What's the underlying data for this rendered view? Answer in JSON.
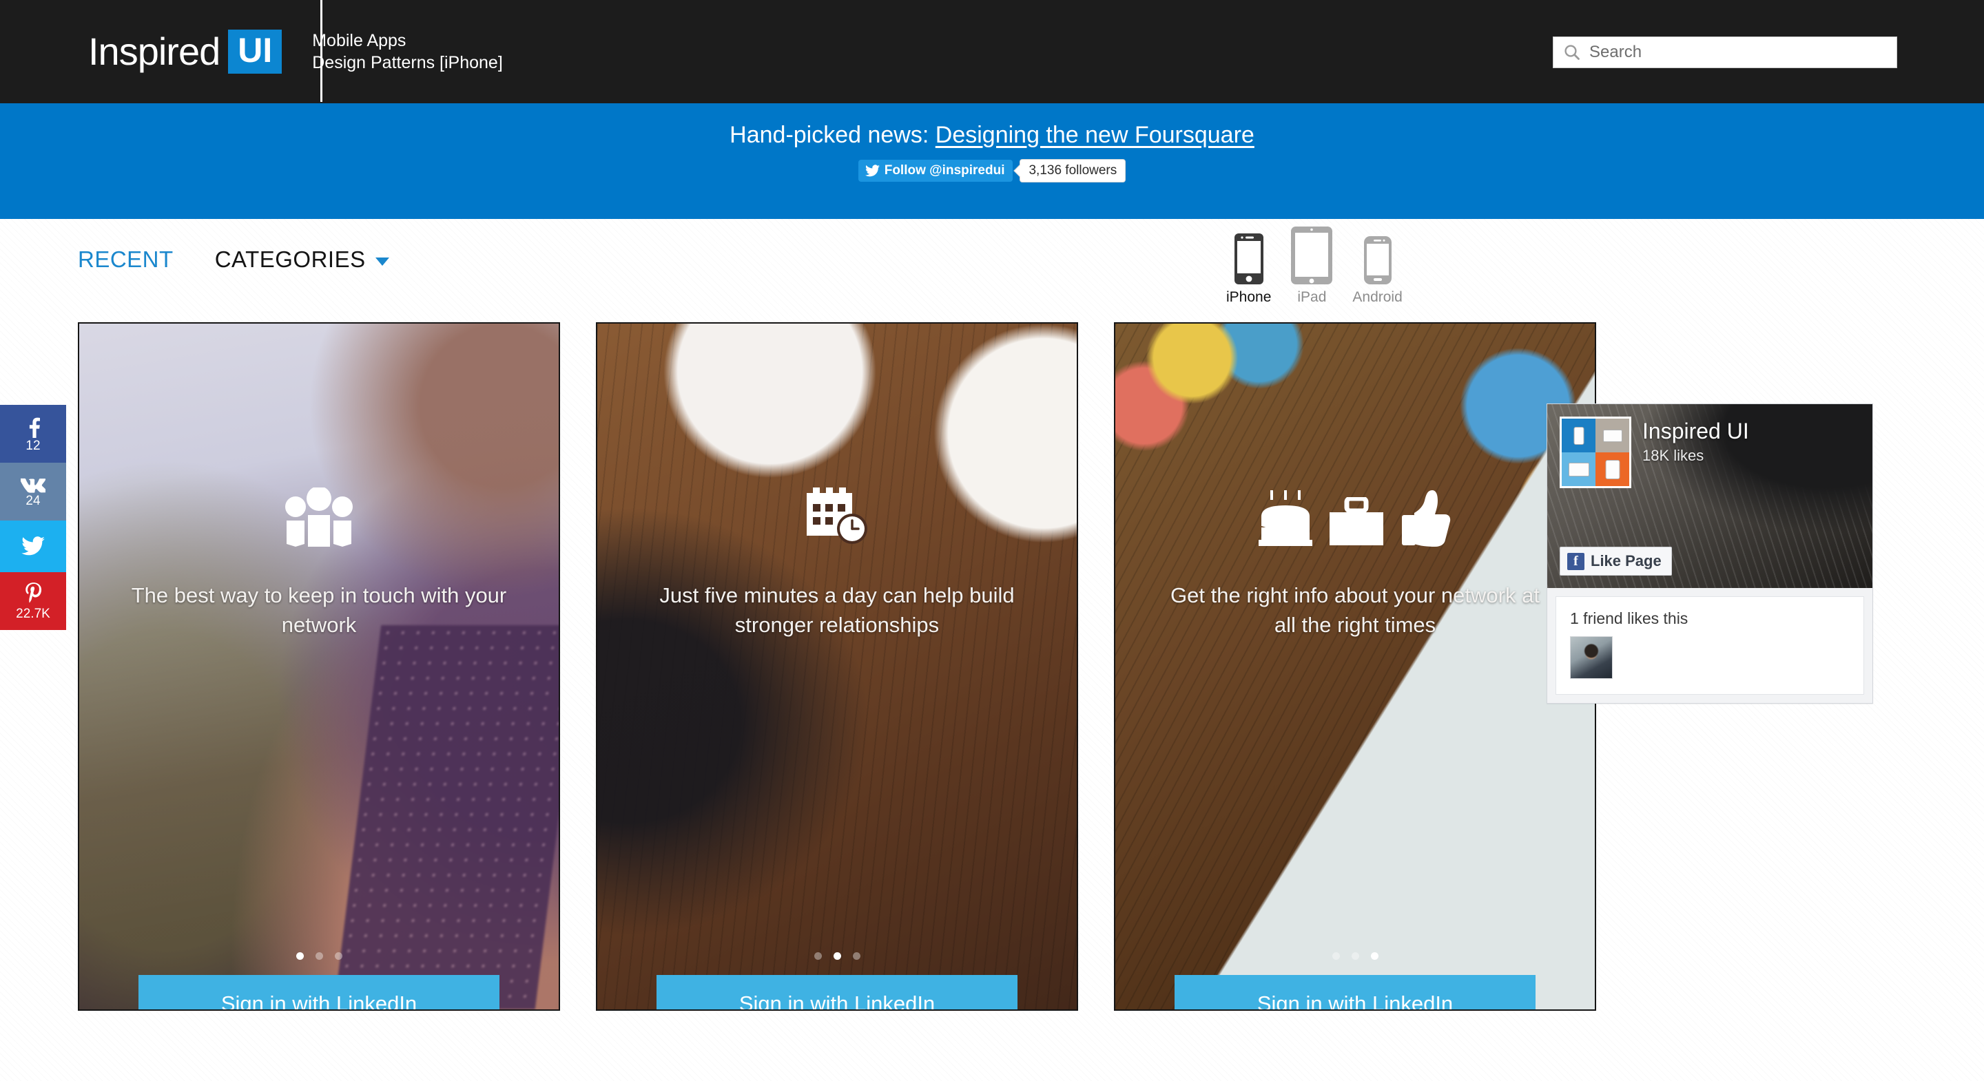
{
  "header": {
    "logo_word": "Inspired",
    "logo_badge": "UI",
    "tagline_line1": "Mobile Apps",
    "tagline_line2": "Design Patterns [iPhone]",
    "search_placeholder": "Search",
    "search_value": "",
    "background_color": "#1c1c1c",
    "accent_color": "#0c86d1"
  },
  "news_banner": {
    "prefix": "Hand-picked news:",
    "link_text": "Designing the new Foursquare",
    "twitter_follow_label": "Follow @inspiredui",
    "twitter_followers": "3,136 followers",
    "background_color": "#0077c8"
  },
  "toolbar": {
    "tabs": [
      {
        "label": "RECENT",
        "active": true
      },
      {
        "label": "CATEGORIES",
        "active": false,
        "has_dropdown": true
      }
    ],
    "devices": [
      {
        "label": "iPhone",
        "active": true
      },
      {
        "label": "iPad",
        "active": false
      },
      {
        "label": "Android",
        "active": false
      }
    ]
  },
  "social_rail": [
    {
      "network": "facebook",
      "count": "12",
      "color": "#36549b"
    },
    {
      "network": "vk",
      "count": "24",
      "color": "#6383a8"
    },
    {
      "network": "twitter",
      "count": "",
      "color": "#1cb0f0"
    },
    {
      "network": "pinterest",
      "count": "22.7K",
      "color": "#d32027"
    }
  ],
  "cards": [
    {
      "icons": [
        "people-group-icon"
      ],
      "caption": "The best way to keep in touch with your network",
      "dots_total": 3,
      "dots_active": 1,
      "signin_label": "Sign in with LinkedIn"
    },
    {
      "icons": [
        "calendar-clock-icon"
      ],
      "caption": "Just five minutes a day can help build stronger relationships",
      "dots_total": 3,
      "dots_active": 2,
      "signin_label": "Sign in with LinkedIn"
    },
    {
      "icons": [
        "birthday-cake-icon",
        "briefcase-icon",
        "thumbs-up-icon"
      ],
      "caption": "Get the right info about your network at all the right times",
      "dots_total": 3,
      "dots_active": 3,
      "signin_label": "Sign in with LinkedIn"
    }
  ],
  "facebook_widget": {
    "page_name": "Inspired UI",
    "likes": "18K likes",
    "like_button_label": "Like Page",
    "friends_text": "1 friend likes this"
  }
}
